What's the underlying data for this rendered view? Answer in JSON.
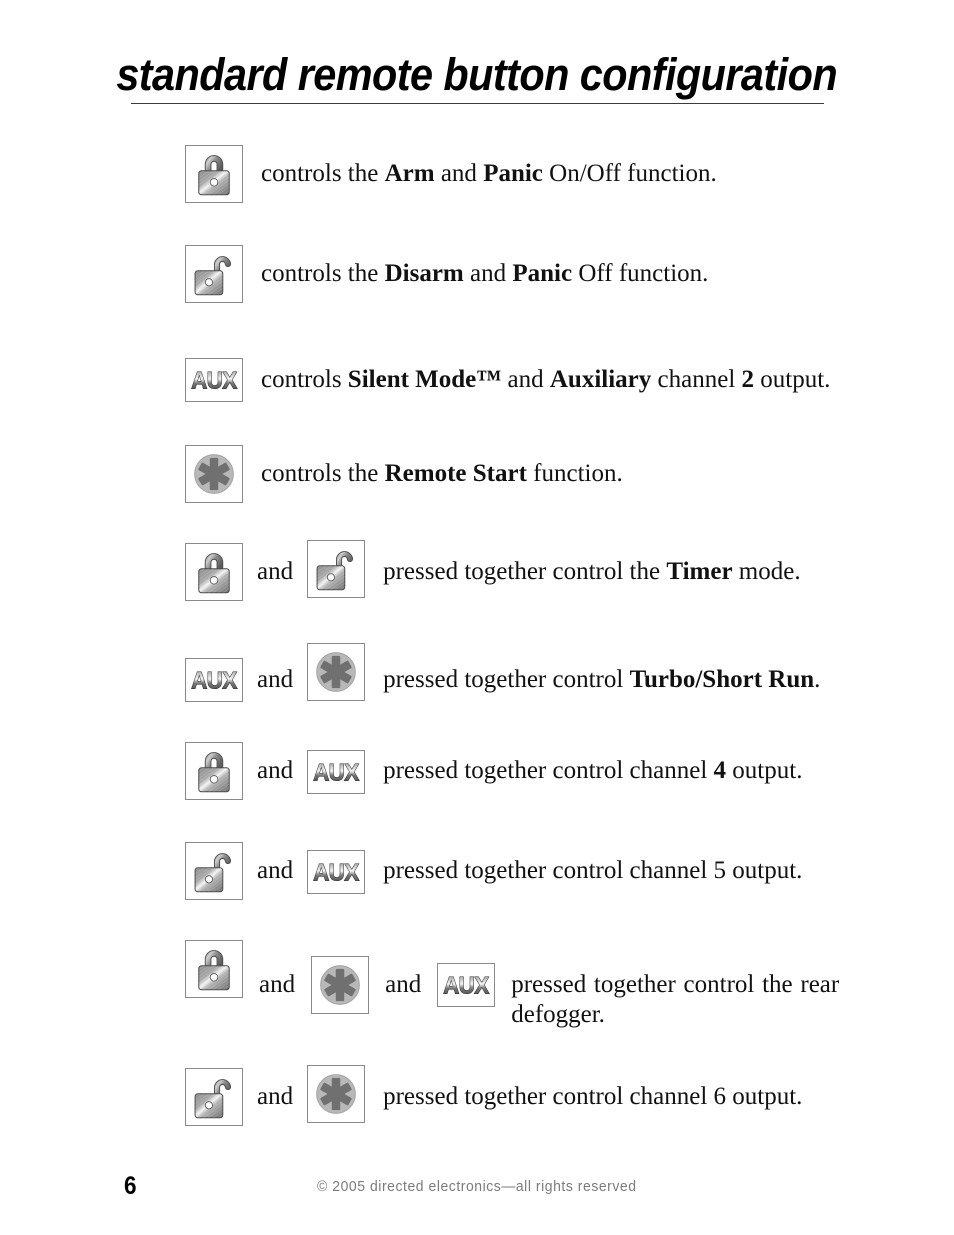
{
  "title": "standard remote button configuration",
  "icons": {
    "lock": "lock-closed-icon",
    "unlock": "lock-open-icon",
    "aux": "aux-button-icon",
    "star": "star-asterisk-icon"
  },
  "and_label": "and",
  "colors": {
    "icon_border": "#8a8a8a",
    "metal_light": "#f2f2f2",
    "metal_mid": "#9a9a9a",
    "metal_dark": "#4a4a4a",
    "star_circle": "#b8b8b8",
    "star_glyph": "#707070",
    "footer_text": "#7b7b7b",
    "rule": "#3a3a3a"
  },
  "rows": [
    {
      "id": "arm-panic",
      "icons": [
        "lock"
      ],
      "parts": [
        {
          "text": "controls the ",
          "bold": false
        },
        {
          "text": "Arm",
          "bold": true
        },
        {
          "text": " and ",
          "bold": false
        },
        {
          "text": "Panic",
          "bold": true
        },
        {
          "text": " On/Off function.",
          "bold": false
        }
      ]
    },
    {
      "id": "disarm-panic",
      "icons": [
        "unlock"
      ],
      "parts": [
        {
          "text": "controls the ",
          "bold": false
        },
        {
          "text": "Disarm",
          "bold": true
        },
        {
          "text": " and ",
          "bold": false
        },
        {
          "text": "Panic",
          "bold": true
        },
        {
          "text": " Off function.",
          "bold": false
        }
      ]
    },
    {
      "id": "silent-mode-aux",
      "icons": [
        "aux"
      ],
      "parts": [
        {
          "text": "controls ",
          "bold": false
        },
        {
          "text": "Silent Mode™",
          "bold": true
        },
        {
          "text": " and ",
          "bold": false
        },
        {
          "text": "Auxiliary",
          "bold": true
        },
        {
          "text": " channel ",
          "bold": false
        },
        {
          "text": "2",
          "bold": true
        },
        {
          "text": " output.",
          "bold": false
        }
      ]
    },
    {
      "id": "remote-start",
      "icons": [
        "star"
      ],
      "parts": [
        {
          "text": "controls the ",
          "bold": false
        },
        {
          "text": "Remote Start",
          "bold": true
        },
        {
          "text": " function.",
          "bold": false
        }
      ]
    },
    {
      "id": "timer-mode",
      "icons": [
        "lock",
        "unlock"
      ],
      "parts": [
        {
          "text": "pressed together control the ",
          "bold": false
        },
        {
          "text": "Timer",
          "bold": true
        },
        {
          "text": " mode.",
          "bold": false
        }
      ]
    },
    {
      "id": "turbo-short-run",
      "icons": [
        "aux",
        "star"
      ],
      "parts": [
        {
          "text": "pressed together control ",
          "bold": false
        },
        {
          "text": "Turbo/Short Run",
          "bold": true
        },
        {
          "text": ".",
          "bold": false
        }
      ]
    },
    {
      "id": "channel-4",
      "icons": [
        "lock",
        "aux"
      ],
      "parts": [
        {
          "text": "pressed together control channel ",
          "bold": false
        },
        {
          "text": "4",
          "bold": true
        },
        {
          "text": " output.",
          "bold": false
        }
      ]
    },
    {
      "id": "channel-5",
      "icons": [
        "unlock",
        "aux"
      ],
      "parts": [
        {
          "text": "pressed together control channel 5 output.",
          "bold": false
        }
      ]
    },
    {
      "id": "rear-defogger",
      "icons": [
        "lock",
        "star",
        "aux"
      ],
      "parts": [
        {
          "text": "pressed together control the rear defogger.",
          "bold": false
        }
      ]
    },
    {
      "id": "channel-6",
      "icons": [
        "unlock",
        "star"
      ],
      "parts": [
        {
          "text": "pressed together control channel 6 output.",
          "bold": false
        }
      ]
    }
  ],
  "footer": {
    "page_number": "6",
    "copyright": "© 2005 directed electronics—all rights reserved"
  }
}
